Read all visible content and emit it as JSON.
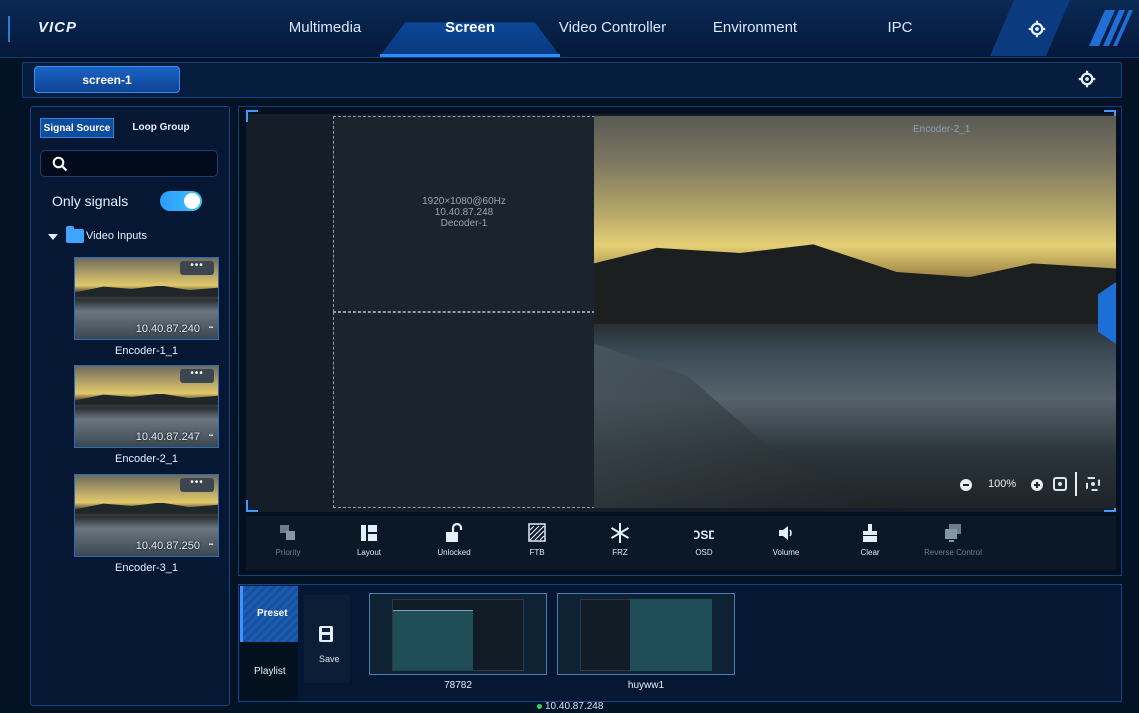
{
  "app": {
    "brand": "VICP"
  },
  "nav": {
    "tabs": [
      {
        "label": "Multimedia"
      },
      {
        "label": "Screen"
      },
      {
        "label": "Video Controller"
      },
      {
        "label": "Environment"
      },
      {
        "label": "IPC"
      }
    ],
    "active": "Screen",
    "settings_icon": "gear-icon"
  },
  "screen_tabs": {
    "items": [
      {
        "label": "screen-1"
      }
    ],
    "settings_icon": "gear-icon"
  },
  "left_panel": {
    "tabs": [
      {
        "label": "Signal Source"
      },
      {
        "label": "Loop Group"
      }
    ],
    "search": {
      "value": "",
      "icon": "search-icon"
    },
    "only_signals": {
      "label": "Only signals",
      "on": true
    },
    "tree": {
      "folder_label": "Video Inputs",
      "expanded": true
    },
    "encoders": [
      {
        "name": "Encoder-1_1",
        "ip": "10.40.87.240"
      },
      {
        "name": "Encoder-2_1",
        "ip": "10.40.87.247"
      },
      {
        "name": "Encoder-3_1",
        "ip": "10.40.87.250"
      }
    ],
    "more_label": "•••"
  },
  "canvas": {
    "decoder": {
      "resolution": "1920×1080@60Hz",
      "ip": "10.40.87.248",
      "name": "Decoder-1"
    },
    "video_window": {
      "title": "Encoder-2_1"
    },
    "zoom": {
      "value": "100%"
    }
  },
  "toolbar": {
    "items": [
      {
        "label": "Priority",
        "icon": "priority-icon",
        "enabled": false
      },
      {
        "label": "Layout",
        "icon": "layout-icon",
        "enabled": true
      },
      {
        "label": "Unlocked",
        "icon": "unlock-icon",
        "enabled": true
      },
      {
        "label": "FTB",
        "icon": "ftb-icon",
        "enabled": true
      },
      {
        "label": "FRZ",
        "icon": "snowflake-icon",
        "enabled": true
      },
      {
        "label": "OSD",
        "icon": "osd-icon",
        "enabled": true
      },
      {
        "label": "Volume",
        "icon": "volume-icon",
        "enabled": true
      },
      {
        "label": "Clear",
        "icon": "clear-icon",
        "enabled": true
      },
      {
        "label": "Reverse Control",
        "icon": "reverse-control-icon",
        "enabled": false
      }
    ]
  },
  "presets": {
    "tabs": [
      {
        "label": "Preset"
      },
      {
        "label": "Playlist"
      }
    ],
    "save_label": "Save",
    "items": [
      {
        "name": "78782"
      },
      {
        "name": "huyww1"
      }
    ]
  },
  "status": {
    "ip": "10.40.87.248",
    "color": "#27d86a"
  },
  "colors": {
    "accent": "#2d8cff",
    "background": "#041226",
    "panel": "#061734"
  }
}
